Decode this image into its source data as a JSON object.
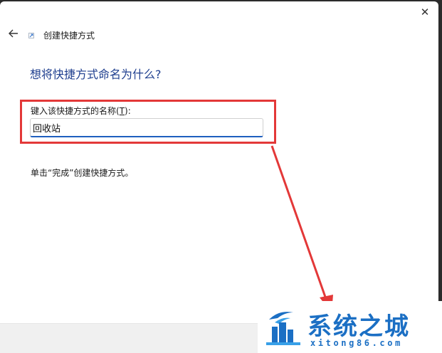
{
  "window": {
    "wizard_title": "创建快捷方式",
    "close_glyph": "✕"
  },
  "page": {
    "heading": "想将快捷方式命名为什么?",
    "field_label_prefix": "键入该快捷方式的名称(",
    "field_label_hotkey": "T",
    "field_label_suffix": "):",
    "name_value": "回收站",
    "instruction": "单击“完成”创建快捷方式。"
  },
  "watermark": {
    "brand": "系统之城",
    "domain": "xitong86.com"
  },
  "colors": {
    "heading": "#1f3f8f",
    "input_focus": "#1f5fbf",
    "annotation": "#e33838",
    "watermark": "#1b6fc4"
  },
  "icons": {
    "back": "back-arrow-icon",
    "close": "close-icon",
    "wizard": "shortcut-wizard-icon"
  }
}
